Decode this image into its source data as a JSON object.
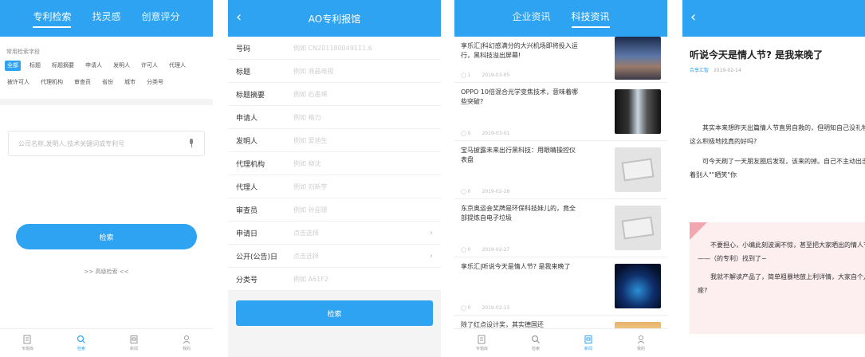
{
  "screen1": {
    "tabs": [
      "专利检索",
      "找灵感",
      "创意评分"
    ],
    "fields_label": "常用检索字段",
    "chips": [
      "全部",
      "标题",
      "标题摘要",
      "申请人",
      "发明人",
      "许可人",
      "代理人",
      "被许可人",
      "代理机构",
      "审查员",
      "省份",
      "城市",
      "分类号"
    ],
    "search_placeholder": "公司名称,发明人,技术关键词或专利号",
    "search_button": "检索",
    "advanced_link": ">> 高级检索 <<",
    "nav": [
      "专题库",
      "检索",
      "新闻",
      "我的"
    ]
  },
  "screen2": {
    "title": "AO专利报馆",
    "fields": [
      {
        "label": "号码",
        "placeholder": "例如 CN201180049111.6"
      },
      {
        "label": "标题",
        "placeholder": "例如 液晶电视"
      },
      {
        "label": "标题摘要",
        "placeholder": "例如 石墨烯"
      },
      {
        "label": "申请人",
        "placeholder": "例如 格力"
      },
      {
        "label": "发明人",
        "placeholder": "例如 爱迪生"
      },
      {
        "label": "代理机构",
        "placeholder": "例如 柳沈"
      },
      {
        "label": "代理人",
        "placeholder": "例如 刘新宇"
      },
      {
        "label": "审查员",
        "placeholder": "例如 孙迎璟"
      },
      {
        "label": "申请日",
        "placeholder": "点击选择"
      },
      {
        "label": "公开(公告)日",
        "placeholder": "点击选择"
      },
      {
        "label": "分类号",
        "placeholder": "例如 A61F2"
      }
    ],
    "search_button": "检索"
  },
  "screen3": {
    "tabs": [
      "企业资讯",
      "科技资讯"
    ],
    "news": [
      {
        "title": "享乐汇|科幻感满分的大兴机场即将投入运行，黑科技溢出屏幕!",
        "views": "1",
        "date": "2019-03-05"
      },
      {
        "title": "OPPO 10倍混合光学变焦技术，意味着哪些突破?",
        "views": "0",
        "date": "2019-03-01"
      },
      {
        "title": "宝马披露未来出行黑科技：用眼睛操控仪表盘",
        "views": "0",
        "date": "2019-02-28"
      },
      {
        "title": "东京奥运会奖牌是环保科技妹儿的，竟全部提炼自电子垃圾",
        "views": "0",
        "date": "2019-02-27"
      },
      {
        "title": "享乐汇|听说今天是情人节? 是我来晚了",
        "views": "0",
        "date": "2019-02-15"
      },
      {
        "title": "除了红点设计奖，其实德国还"
      }
    ],
    "nav": [
      "专题库",
      "检索",
      "新闻",
      "我的"
    ]
  },
  "screen4": {
    "title": "听说今天是情人节? 是我来晚了",
    "source": "合享汇智",
    "date": "2019-02-14",
    "para1": "其实本来想昨天出篇情人节直男自救的，但明知自己没礼物收，还这么积极地找真的好吗?",
    "para2": "可今天刷了一天朋友圈后发现，该来的掉。自己不主动出击，就等着别人\"\"晒笑\"你",
    "quote1": "不要担心，小编此刻波澜不惊，甚至把大家晒出的情人节礼物——（的专利）找到了~",
    "quote2": "我就不解读产品了，简单粗暴地放上利详情，大家自个儿对号入座?"
  },
  "colors": {
    "primary": "#2ea3f2",
    "quote_bg": "#fdeef0",
    "quote_corner": "#f2a7b0"
  }
}
